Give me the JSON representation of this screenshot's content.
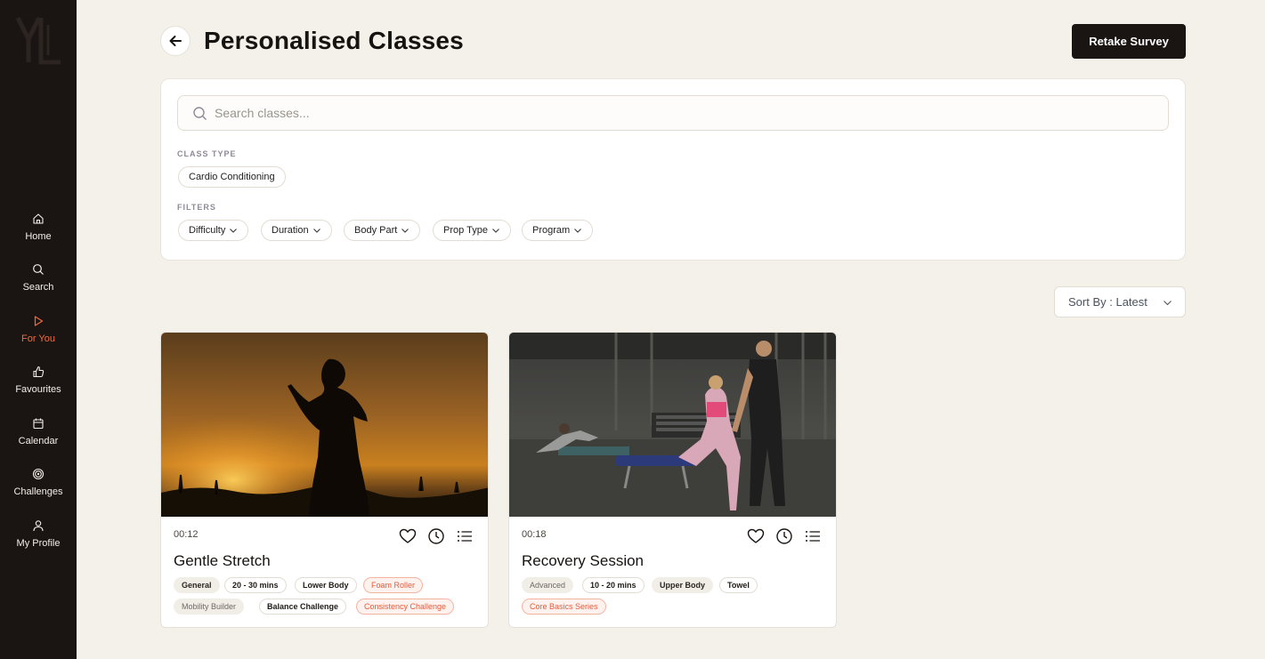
{
  "sidebar": {
    "items": [
      {
        "label": "Home",
        "icon": "home-icon"
      },
      {
        "label": "Search",
        "icon": "search-icon"
      },
      {
        "label": "For You",
        "icon": "play-icon",
        "active": true
      },
      {
        "label": "Favourites",
        "icon": "thumbs-up-icon"
      },
      {
        "label": "Calendar",
        "icon": "calendar-icon"
      },
      {
        "label": "Challenges",
        "icon": "target-icon"
      },
      {
        "label": "My Profile",
        "icon": "user-icon"
      }
    ]
  },
  "header": {
    "title": "Personalised Classes",
    "retake_label": "Retake Survey"
  },
  "filters": {
    "search_placeholder": "Search classes...",
    "class_type_label": "CLASS TYPE",
    "class_types": [
      "Cardio Conditioning"
    ],
    "filters_label": "FILTERS",
    "dropdowns": [
      "Difficulty",
      "Duration",
      "Body Part",
      "Prop Type",
      "Program"
    ]
  },
  "sort": {
    "label": "Sort By : Latest"
  },
  "cards": [
    {
      "duration": "00:12",
      "title": "Gentle Stretch",
      "tags_row1": [
        {
          "text": "General",
          "style": "grey"
        },
        {
          "text": "20 - 30 mins",
          "style": "outline"
        },
        {
          "text": "Lower Body",
          "style": "outline"
        },
        {
          "text": "Foam Roller",
          "style": "orange"
        }
      ],
      "tags_row2": [
        {
          "text": "Mobility Builder",
          "style": "grey-light"
        },
        {
          "text": "Balance Challenge",
          "style": "outline"
        },
        {
          "text": "Consistency Challenge",
          "style": "orange"
        }
      ]
    },
    {
      "duration": "00:18",
      "title": "Recovery Session",
      "tags_row1": [
        {
          "text": "Advanced",
          "style": "grey-light"
        },
        {
          "text": "10 - 20 mins",
          "style": "outline"
        },
        {
          "text": "Upper Body",
          "style": "grey"
        },
        {
          "text": "Towel",
          "style": "outline"
        }
      ],
      "tags_row2": [
        {
          "text": "Core Basics Series",
          "style": "orange"
        }
      ]
    }
  ],
  "colors": {
    "accent": "#f46a3c",
    "sidebar_bg": "#1a1512",
    "page_bg": "#f4f1ea"
  }
}
